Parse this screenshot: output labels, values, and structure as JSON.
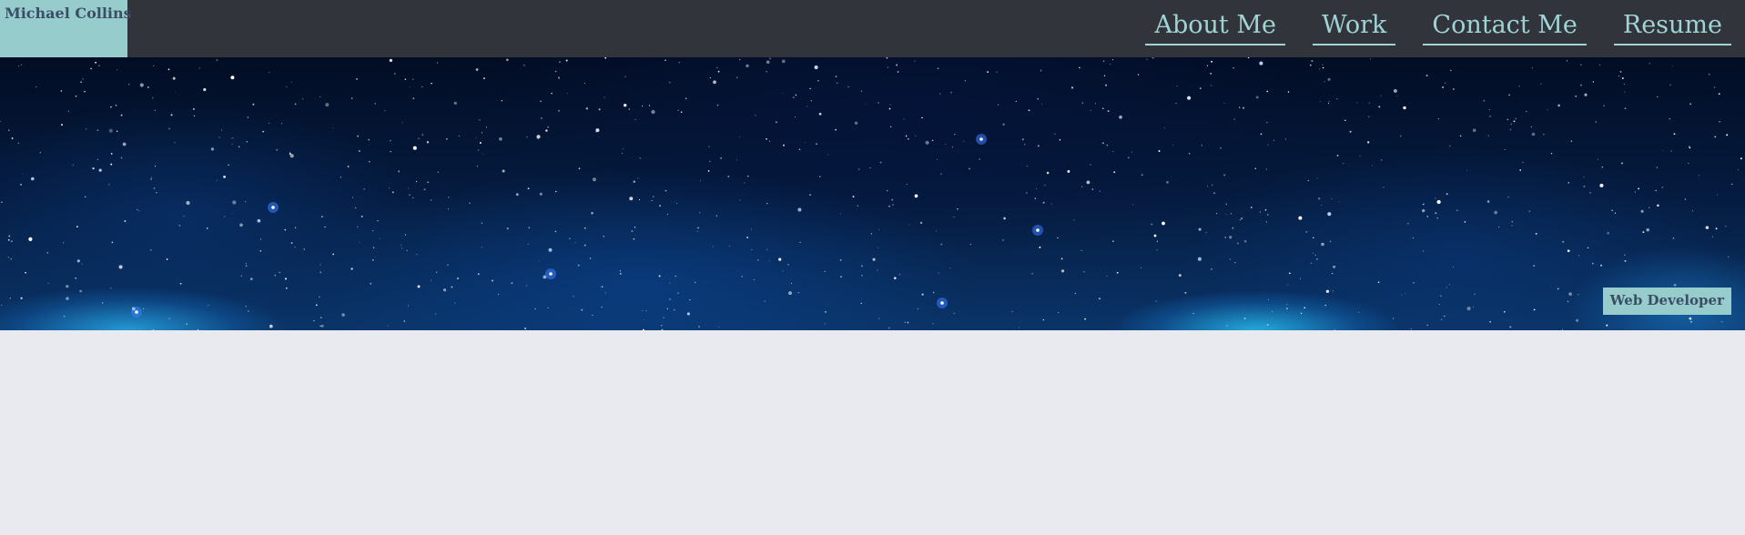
{
  "header": {
    "brand": "Michael Collins",
    "nav": [
      {
        "label": "About Me"
      },
      {
        "label": "Work"
      },
      {
        "label": "Contact Me"
      },
      {
        "label": "Resume"
      }
    ]
  },
  "hero": {
    "badge": "Web Developer"
  },
  "colors": {
    "header_bg": "#32343c",
    "accent": "#97cccc",
    "brand_text": "#3a4e66",
    "nav_text": "#9fd4d4",
    "page_bg": "#e9eaef"
  }
}
